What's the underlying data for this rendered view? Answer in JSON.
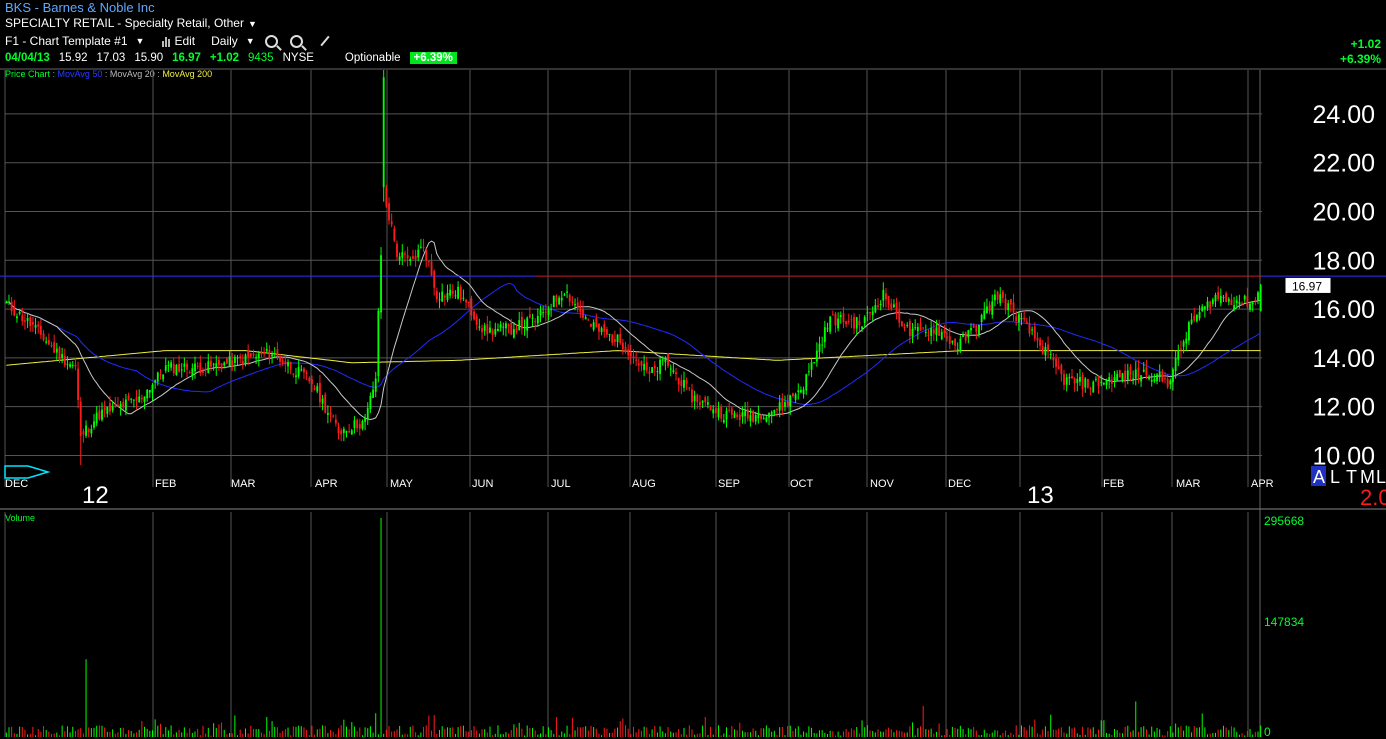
{
  "header": {
    "title": "BKS - Barnes & Noble Inc",
    "industry": "SPECIALTY RETAIL - Specialty Retail, Other"
  },
  "toolbar": {
    "template": "F1 - Chart Template #1",
    "edit": "Edit",
    "period": "Daily"
  },
  "quote": {
    "date": "04/04/13",
    "open": "15.92",
    "high": "17.03",
    "low": "15.90",
    "close": "16.97",
    "change": "+1.02",
    "volume": "9435",
    "exchange": "NYSE",
    "optionable": "Optionable",
    "change_pct": "+6.39%"
  },
  "right_change": {
    "change": "+1.02",
    "pct": "+6.39%"
  },
  "legend": {
    "price_chart": "Price Chart :",
    "ma50": "MovAvg 50",
    "ma20": "MovAvg 20",
    "ma200": "MovAvg 200"
  },
  "colors": {
    "up": "#00ff00",
    "down": "#ff1a1a",
    "ma50": "#1f2bff",
    "ma20": "#c8c8c8",
    "ma200": "#f0f040",
    "grid": "#555555",
    "hline_blue": "#3030ff",
    "hline_red": "#c02020"
  },
  "chart_data": {
    "type": "candlestick",
    "price_axis": {
      "ticks": [
        "10.00",
        "12.00",
        "14.00",
        "16.00",
        "18.00",
        "20.00",
        "22.00",
        "24.00"
      ],
      "ylim": [
        9.2,
        25.8
      ]
    },
    "last_price_label": "16.97",
    "horizontal_line": 17.35,
    "month_labels": [
      "DEC",
      "FEB",
      "MAR",
      "APR",
      "MAY",
      "JUN",
      "JUL",
      "AUG",
      "SEP",
      "OCT",
      "NOV",
      "DEC",
      "FEB",
      "MAR",
      "APR"
    ],
    "year_labels": [
      "12",
      "13"
    ],
    "price_anchors": [
      [
        0,
        16.2
      ],
      [
        10,
        15.3
      ],
      [
        20,
        14.1
      ],
      [
        26,
        13.6
      ],
      [
        28,
        10.8
      ],
      [
        35,
        11.7
      ],
      [
        50,
        12.3
      ],
      [
        60,
        13.6
      ],
      [
        75,
        13.6
      ],
      [
        100,
        14.2
      ],
      [
        115,
        13.0
      ],
      [
        125,
        11.0
      ],
      [
        135,
        11.4
      ],
      [
        139,
        13.2
      ],
      [
        142,
        20.8
      ],
      [
        147,
        18.3
      ],
      [
        152,
        17.9
      ],
      [
        157,
        18.6
      ],
      [
        162,
        16.6
      ],
      [
        170,
        16.7
      ],
      [
        180,
        15.1
      ],
      [
        190,
        15.2
      ],
      [
        200,
        15.6
      ],
      [
        210,
        16.8
      ],
      [
        220,
        15.3
      ],
      [
        232,
        14.6
      ],
      [
        242,
        13.3
      ],
      [
        248,
        13.9
      ],
      [
        258,
        12.4
      ],
      [
        270,
        11.7
      ],
      [
        280,
        11.6
      ],
      [
        292,
        12.0
      ],
      [
        300,
        12.9
      ],
      [
        310,
        15.6
      ],
      [
        322,
        15.4
      ],
      [
        330,
        16.6
      ],
      [
        340,
        15.0
      ],
      [
        350,
        15.2
      ],
      [
        358,
        14.5
      ],
      [
        365,
        15.3
      ],
      [
        373,
        16.6
      ],
      [
        382,
        15.5
      ],
      [
        390,
        14.4
      ],
      [
        398,
        13.1
      ],
      [
        408,
        12.9
      ],
      [
        418,
        13.2
      ],
      [
        430,
        13.4
      ],
      [
        437,
        13.0
      ],
      [
        446,
        15.5
      ],
      [
        455,
        16.5
      ],
      [
        466,
        16.3
      ],
      [
        470,
        16.3
      ],
      [
        472,
        16.97
      ]
    ],
    "special_candles": [
      {
        "i": 142,
        "open": 21.0,
        "high": 25.8,
        "low": 20.4,
        "close": 25.5
      },
      {
        "i": 28,
        "open": 12.2,
        "high": 12.4,
        "low": 9.6,
        "close": 10.8
      }
    ],
    "ma200_anchors": [
      [
        0,
        13.7
      ],
      [
        60,
        14.3
      ],
      [
        90,
        14.3
      ],
      [
        130,
        13.8
      ],
      [
        170,
        13.9
      ],
      [
        230,
        14.3
      ],
      [
        290,
        13.9
      ],
      [
        360,
        14.3
      ],
      [
        420,
        14.3
      ],
      [
        472,
        14.3
      ]
    ],
    "volume_axis": {
      "ticks": [
        "295668",
        "147834",
        "0"
      ],
      "max": 295668
    },
    "volume_spikes": [
      {
        "i": 30,
        "v": 105000
      },
      {
        "i": 141,
        "v": 295668
      },
      {
        "i": 345,
        "v": 42000
      },
      {
        "i": 425,
        "v": 48000
      }
    ],
    "volume_label": "Volume"
  },
  "bottom_right": {
    "letters": [
      "A",
      "L",
      "T",
      "M",
      "L"
    ],
    "value": "2.0"
  }
}
